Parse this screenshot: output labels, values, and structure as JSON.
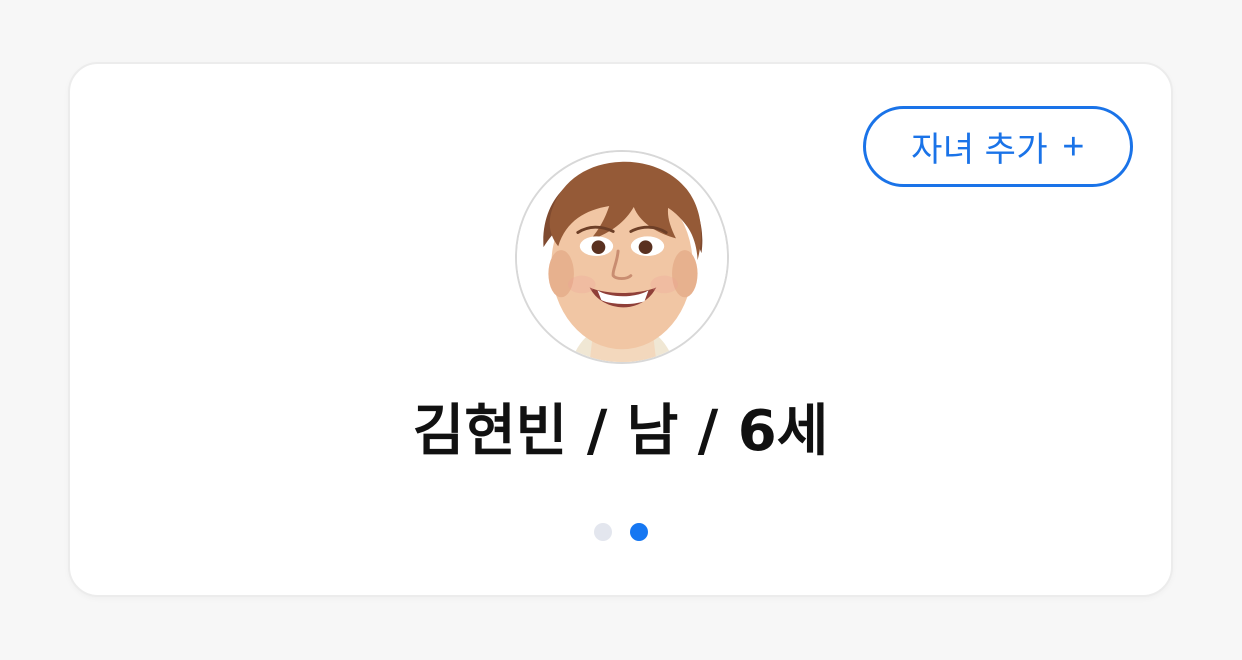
{
  "card": {
    "add_child_button": {
      "label": "자녀 추가",
      "icon": "plus-icon",
      "icon_text": "+",
      "color": "#1a73e8"
    },
    "profile": {
      "avatar": "child-photo",
      "text": "김현빈 / 남 / 6세"
    },
    "pager": {
      "total": 2,
      "active_index": 1,
      "active_color": "#1677f2",
      "inactive_color": "#e3e6ee"
    }
  }
}
